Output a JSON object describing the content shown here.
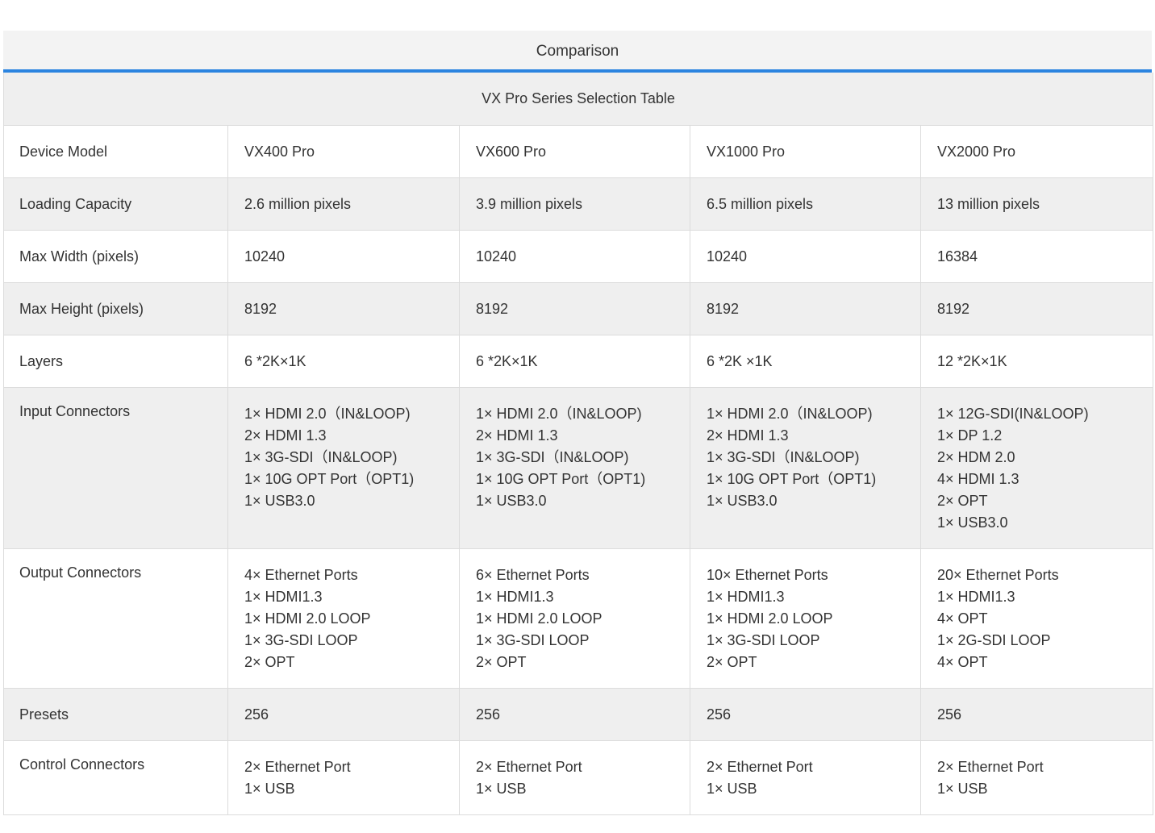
{
  "tab": {
    "label": "Comparison"
  },
  "table": {
    "caption": "VX Pro Series Selection Table",
    "rows": [
      {
        "label": "Device Model",
        "cells": [
          [
            "VX400 Pro"
          ],
          [
            "VX600 Pro"
          ],
          [
            "VX1000 Pro"
          ],
          [
            "VX2000 Pro"
          ]
        ]
      },
      {
        "label": "Loading Capacity",
        "cells": [
          [
            "2.6 million pixels"
          ],
          [
            "3.9 million pixels"
          ],
          [
            "6.5 million pixels"
          ],
          [
            "13 million pixels"
          ]
        ]
      },
      {
        "label": "Max Width (pixels)",
        "cells": [
          [
            "10240"
          ],
          [
            "10240"
          ],
          [
            "10240"
          ],
          [
            "16384"
          ]
        ]
      },
      {
        "label": "Max Height (pixels)",
        "cells": [
          [
            "8192"
          ],
          [
            "8192"
          ],
          [
            "8192"
          ],
          [
            "8192"
          ]
        ]
      },
      {
        "label": "Layers",
        "cells": [
          [
            "6 *2K×1K"
          ],
          [
            "6 *2K×1K"
          ],
          [
            "6 *2K ×1K"
          ],
          [
            "12 *2K×1K"
          ]
        ]
      },
      {
        "label": "Input Connectors",
        "cells": [
          [
            "1× HDMI 2.0（IN&LOOP)",
            "2× HDMI 1.3",
            "1× 3G-SDI（IN&LOOP)",
            "1× 10G OPT Port（OPT1)",
            "1× USB3.0"
          ],
          [
            "1× HDMI 2.0（IN&LOOP)",
            "2× HDMI 1.3",
            "1× 3G-SDI（IN&LOOP)",
            "1× 10G OPT Port（OPT1)",
            "1× USB3.0"
          ],
          [
            "1× HDMI 2.0（IN&LOOP)",
            "2× HDMI 1.3",
            "1× 3G-SDI（IN&LOOP)",
            "1× 10G OPT Port（OPT1)",
            "1× USB3.0"
          ],
          [
            "1× 12G-SDI(IN&LOOP)",
            "1× DP 1.2",
            "2× HDM 2.0",
            "4× HDMI 1.3",
            "2× OPT",
            "1× USB3.0"
          ]
        ]
      },
      {
        "label": "Output Connectors",
        "cells": [
          [
            "4× Ethernet Ports",
            "1× HDMI1.3",
            "1× HDMI 2.0 LOOP",
            "1× 3G-SDI LOOP",
            "2× OPT"
          ],
          [
            "6× Ethernet Ports",
            "1× HDMI1.3",
            "1× HDMI 2.0 LOOP",
            "1× 3G-SDI LOOP",
            "2× OPT"
          ],
          [
            "10× Ethernet Ports",
            "1× HDMI1.3",
            "1× HDMI 2.0 LOOP",
            "1× 3G-SDI LOOP",
            "2× OPT"
          ],
          [
            "20× Ethernet Ports",
            "1× HDMI1.3",
            "4× OPT",
            "1× 2G-SDI LOOP",
            "4× OPT"
          ]
        ]
      },
      {
        "label": "Presets",
        "cells": [
          [
            "256"
          ],
          [
            "256"
          ],
          [
            "256"
          ],
          [
            "256"
          ]
        ]
      },
      {
        "label": "Control Connectors",
        "cells": [
          [
            "2× Ethernet Port",
            "1× USB"
          ],
          [
            "2× Ethernet Port",
            "1× USB"
          ],
          [
            "2× Ethernet Port",
            "1× USB"
          ],
          [
            "2× Ethernet Port",
            "1× USB"
          ]
        ]
      }
    ]
  }
}
